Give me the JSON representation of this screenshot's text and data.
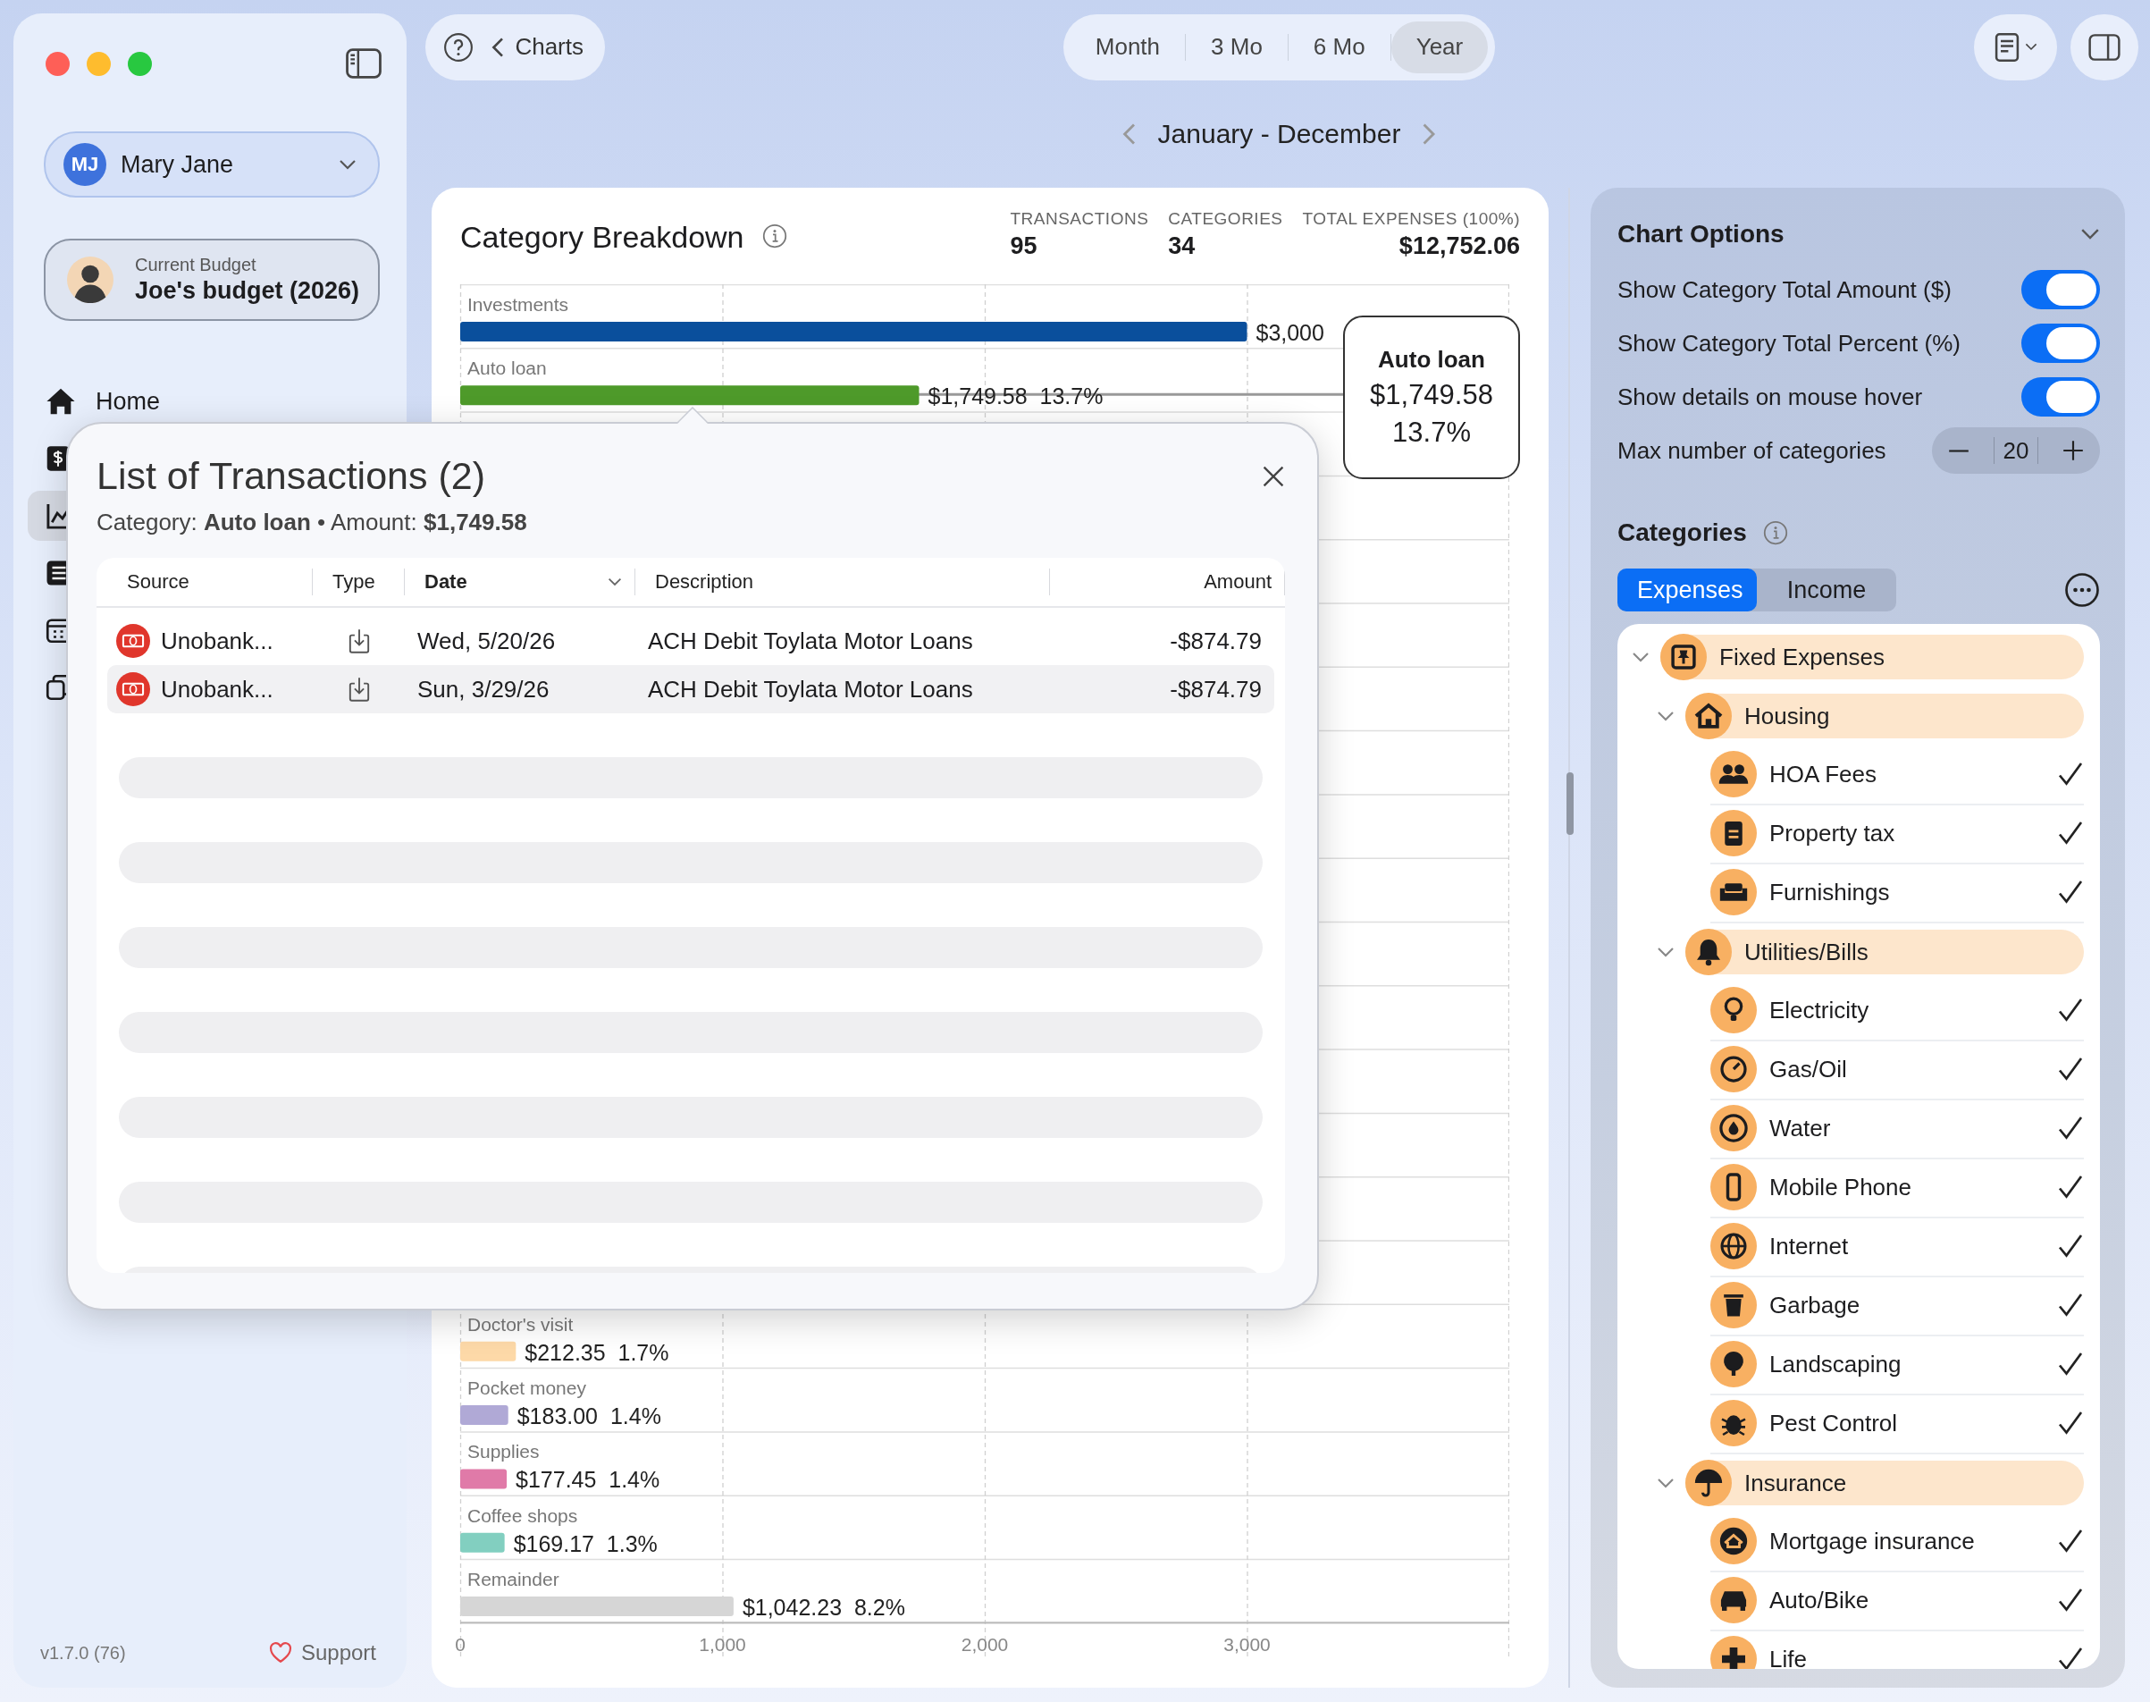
{
  "sidebar": {
    "account": {
      "initials": "MJ",
      "name": "Mary Jane"
    },
    "budget": {
      "caption": "Current Budget",
      "name": "Joe's budget (2026)"
    },
    "nav": [
      {
        "label": "Home",
        "selected": false
      },
      {
        "selected": false
      },
      {
        "selected": true
      },
      {
        "selected": false
      },
      {
        "selected": false
      },
      {
        "selected": false
      }
    ],
    "version": "v1.7.0 (76)",
    "support": "Support"
  },
  "toolbar": {
    "back": "Charts",
    "periods": [
      {
        "label": "Month",
        "selected": false
      },
      {
        "label": "3 Mo",
        "selected": false
      },
      {
        "label": "6 Mo",
        "selected": false
      },
      {
        "label": "Year",
        "selected": true
      }
    ],
    "range": "January - December"
  },
  "breakdown": {
    "title": "Category Breakdown",
    "stats": [
      {
        "label": "TRANSACTIONS",
        "value": "95"
      },
      {
        "label": "CATEGORIES",
        "value": "34"
      },
      {
        "label": "TOTAL EXPENSES (100%)",
        "value": "$12,752.06"
      }
    ],
    "top_rows": [
      {
        "label": "Investments",
        "color": "#0a4f9c",
        "level": 0.75,
        "value_label": "$3,000"
      },
      {
        "label": "Auto loan",
        "color": "#4e9a2a",
        "level": 0.4374,
        "value_label": "$1,749.58  13.7%"
      }
    ],
    "chart_data": {
      "type": "bar",
      "orientation": "horizontal",
      "categories": [
        "Doctor's visit",
        "Pocket money",
        "Supplies",
        "Coffee shops",
        "Remainder"
      ],
      "series": [
        {
          "colors": [
            "#fdd9a8",
            "#b0a9d6",
            "#e07aa8",
            "#82cfc0",
            "#d6d6d6"
          ],
          "values": [
            212.35,
            183.0,
            177.45,
            169.17,
            1042.23
          ]
        }
      ],
      "grid": true,
      "xlim": [
        0,
        4000
      ],
      "xticks": [
        0,
        {
          "value": 1000,
          "label": "1,000"
        },
        {
          "value": 2000,
          "label": "2,000"
        },
        {
          "value": 3000,
          "label": "3,000"
        }
      ],
      "value_labels": [
        "$212.35  1.7%",
        "$183.00  1.4%",
        "$177.45  1.4%",
        "$169.17  1.3%",
        "$1,042.23  8.2%"
      ]
    },
    "hover": {
      "title": "Auto loan",
      "amount": "$1,749.58",
      "percent": "13.7%"
    }
  },
  "transactions_popup": {
    "title": "List of Transactions (2)",
    "subtitle": "Category: **Auto loan**  •  Amount: **$1,749.58**",
    "columns": [
      {
        "label": "Source",
        "sorted": false
      },
      {
        "label": "Type",
        "sorted": false
      },
      {
        "label": "Date",
        "sorted": true
      },
      {
        "label": "Description",
        "sorted": false
      },
      {
        "label": "Amount",
        "sorted": false
      }
    ],
    "rows": [
      {
        "source": "Unobank...",
        "date": "Wed, 5/20/26",
        "description": "ACH Debit Toylata Motor Loans",
        "amount": "-$874.79"
      },
      {
        "source": "Unobank...",
        "date": "Sun, 3/29/26",
        "description": "ACH Debit Toylata Motor Loans",
        "amount": "-$874.79"
      }
    ]
  },
  "chart_options": {
    "title": "Chart Options",
    "toggles": [
      {
        "label": "Show Category Total Amount ($)",
        "on": true
      },
      {
        "label": "Show Category Total Percent (%)",
        "on": true
      },
      {
        "label": "Show details on mouse hover",
        "on": true
      }
    ],
    "stepper": {
      "label": "Max number of categories",
      "value": "20"
    }
  },
  "categories": {
    "title": "Categories",
    "tabs": [
      {
        "label": "Expenses",
        "selected": true
      },
      {
        "label": "Income",
        "selected": false
      }
    ],
    "tree": [
      {
        "label": "Fixed Expenses",
        "expanded": true,
        "children": [
          {
            "label": "Housing",
            "expanded": true,
            "children": [
              {
                "label": "HOA Fees",
                "checked": true
              },
              {
                "label": "Property tax",
                "checked": true
              },
              {
                "label": "Furnishings",
                "checked": true
              }
            ]
          },
          {
            "label": "Utilities/Bills",
            "expanded": true,
            "children": [
              {
                "label": "Electricity",
                "checked": true
              },
              {
                "label": "Gas/Oil",
                "checked": true
              },
              {
                "label": "Water",
                "checked": true
              },
              {
                "label": "Mobile Phone",
                "checked": true
              },
              {
                "label": "Internet",
                "checked": true
              },
              {
                "label": "Garbage",
                "checked": true
              },
              {
                "label": "Landscaping",
                "checked": true
              },
              {
                "label": "Pest Control",
                "checked": true
              }
            ]
          },
          {
            "label": "Insurance",
            "expanded": true,
            "children": [
              {
                "label": "Mortgage insurance",
                "checked": true
              },
              {
                "label": "Auto/Bike",
                "checked": true
              },
              {
                "label": "Life",
                "checked": true
              }
            ]
          }
        ]
      }
    ]
  }
}
